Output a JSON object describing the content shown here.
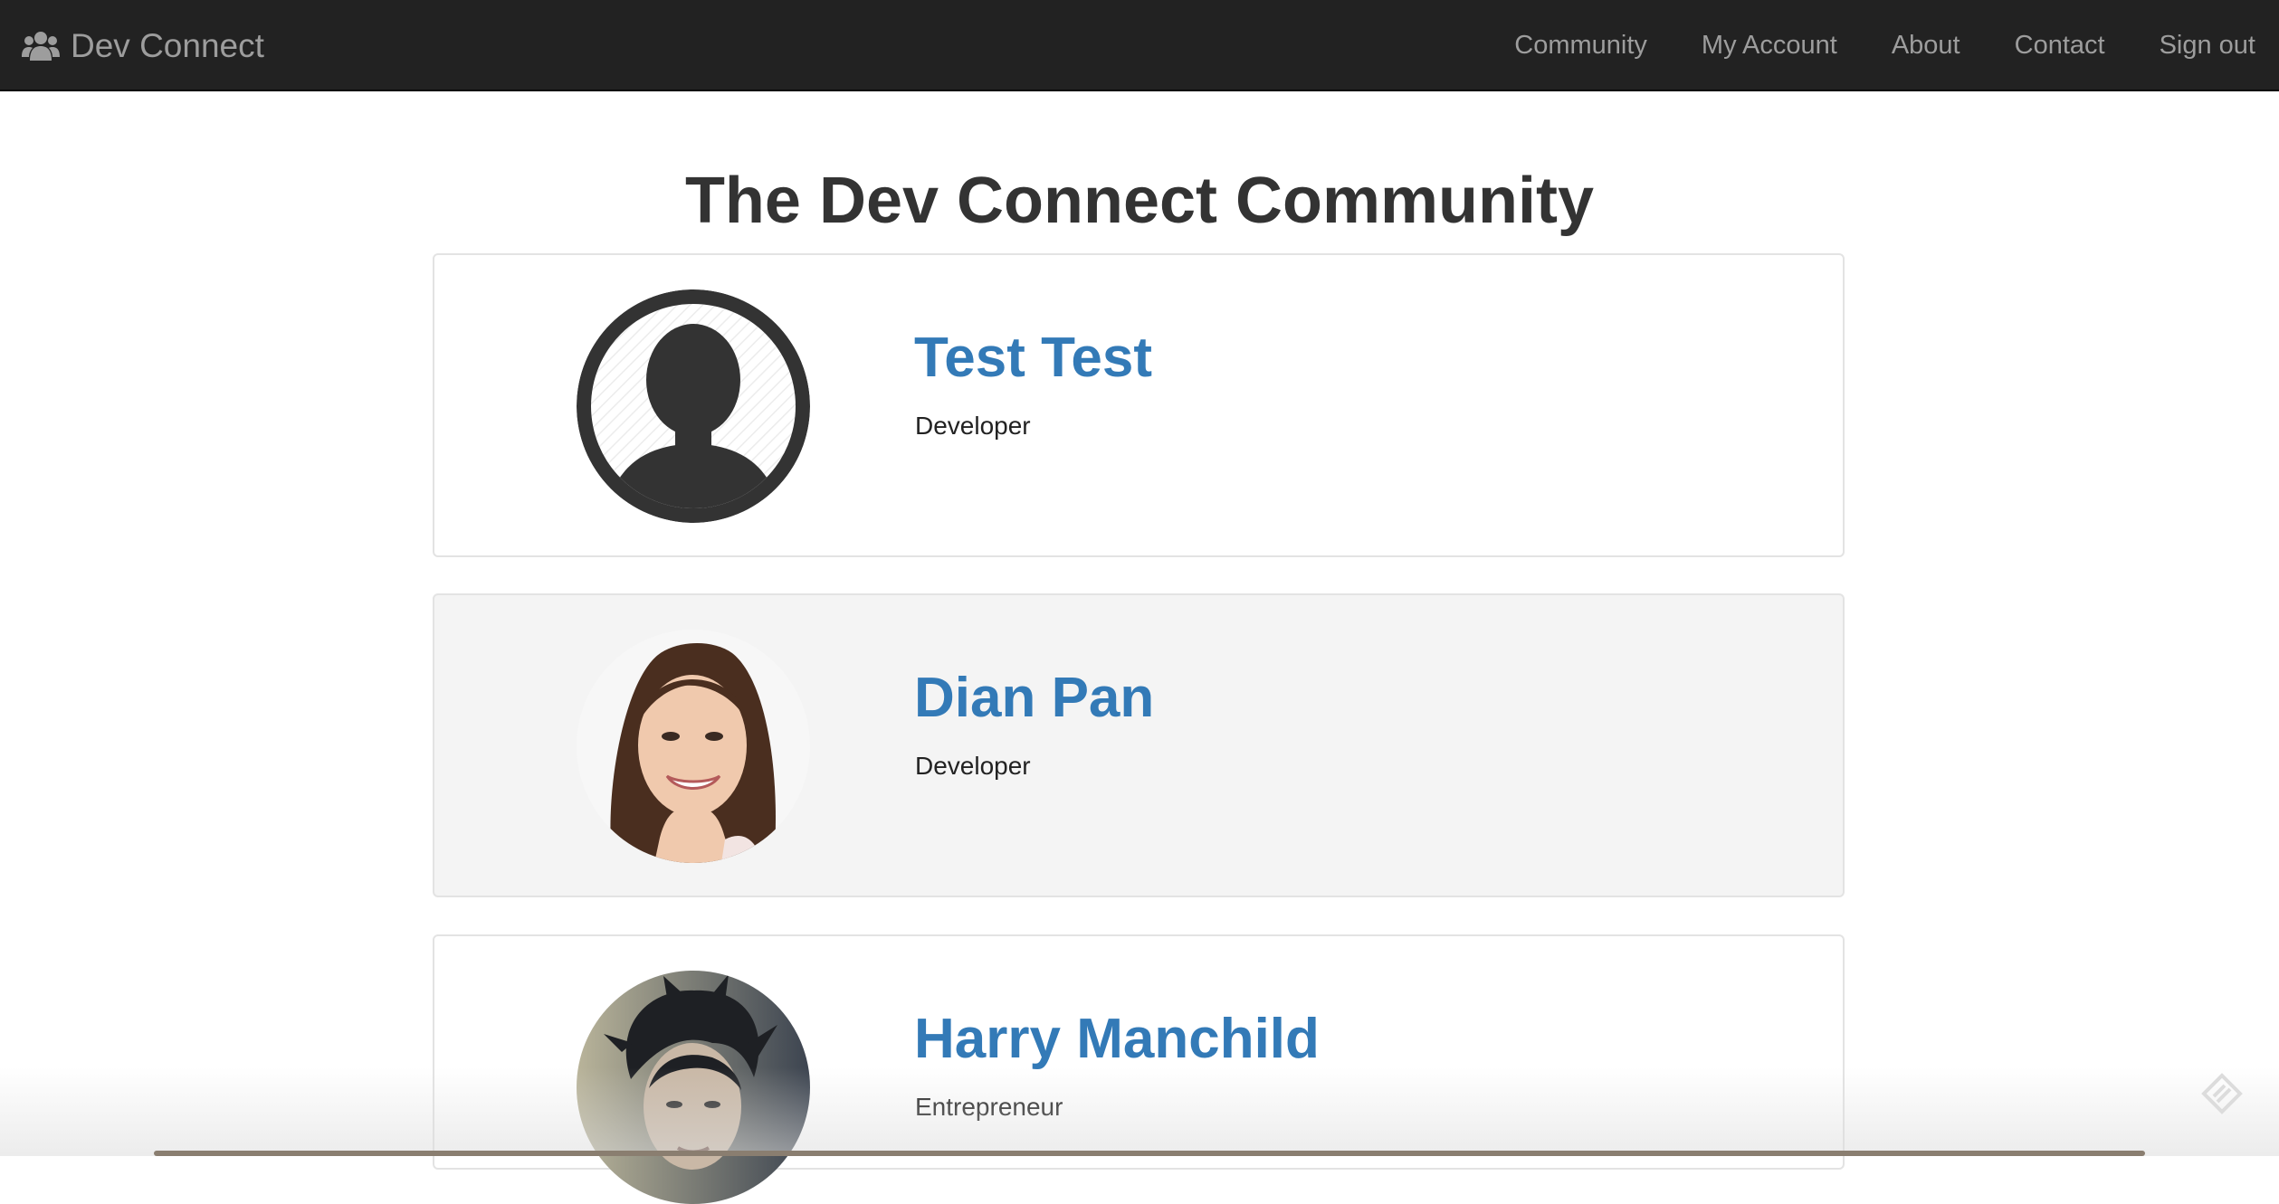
{
  "app": {
    "brand": "Dev Connect",
    "brand_icon": "users-icon"
  },
  "nav": {
    "items": [
      {
        "label": "Community"
      },
      {
        "label": "My Account"
      },
      {
        "label": "About"
      },
      {
        "label": "Contact"
      },
      {
        "label": "Sign out"
      }
    ]
  },
  "main": {
    "title": "The Dev Connect Community",
    "members": [
      {
        "name": "Test Test",
        "role": "Developer",
        "avatar": "default-silhouette"
      },
      {
        "name": "Dian Pan",
        "role": "Developer",
        "avatar": "photo"
      },
      {
        "name": "Harry Manchild",
        "role": "Entrepreneur",
        "avatar": "photo"
      }
    ]
  },
  "colors": {
    "navbar": "#222222",
    "nav_text": "#9d9d9d",
    "link": "#337ab7",
    "card_border": "#e3e3e3",
    "card_alt_bg": "#f4f4f4"
  }
}
